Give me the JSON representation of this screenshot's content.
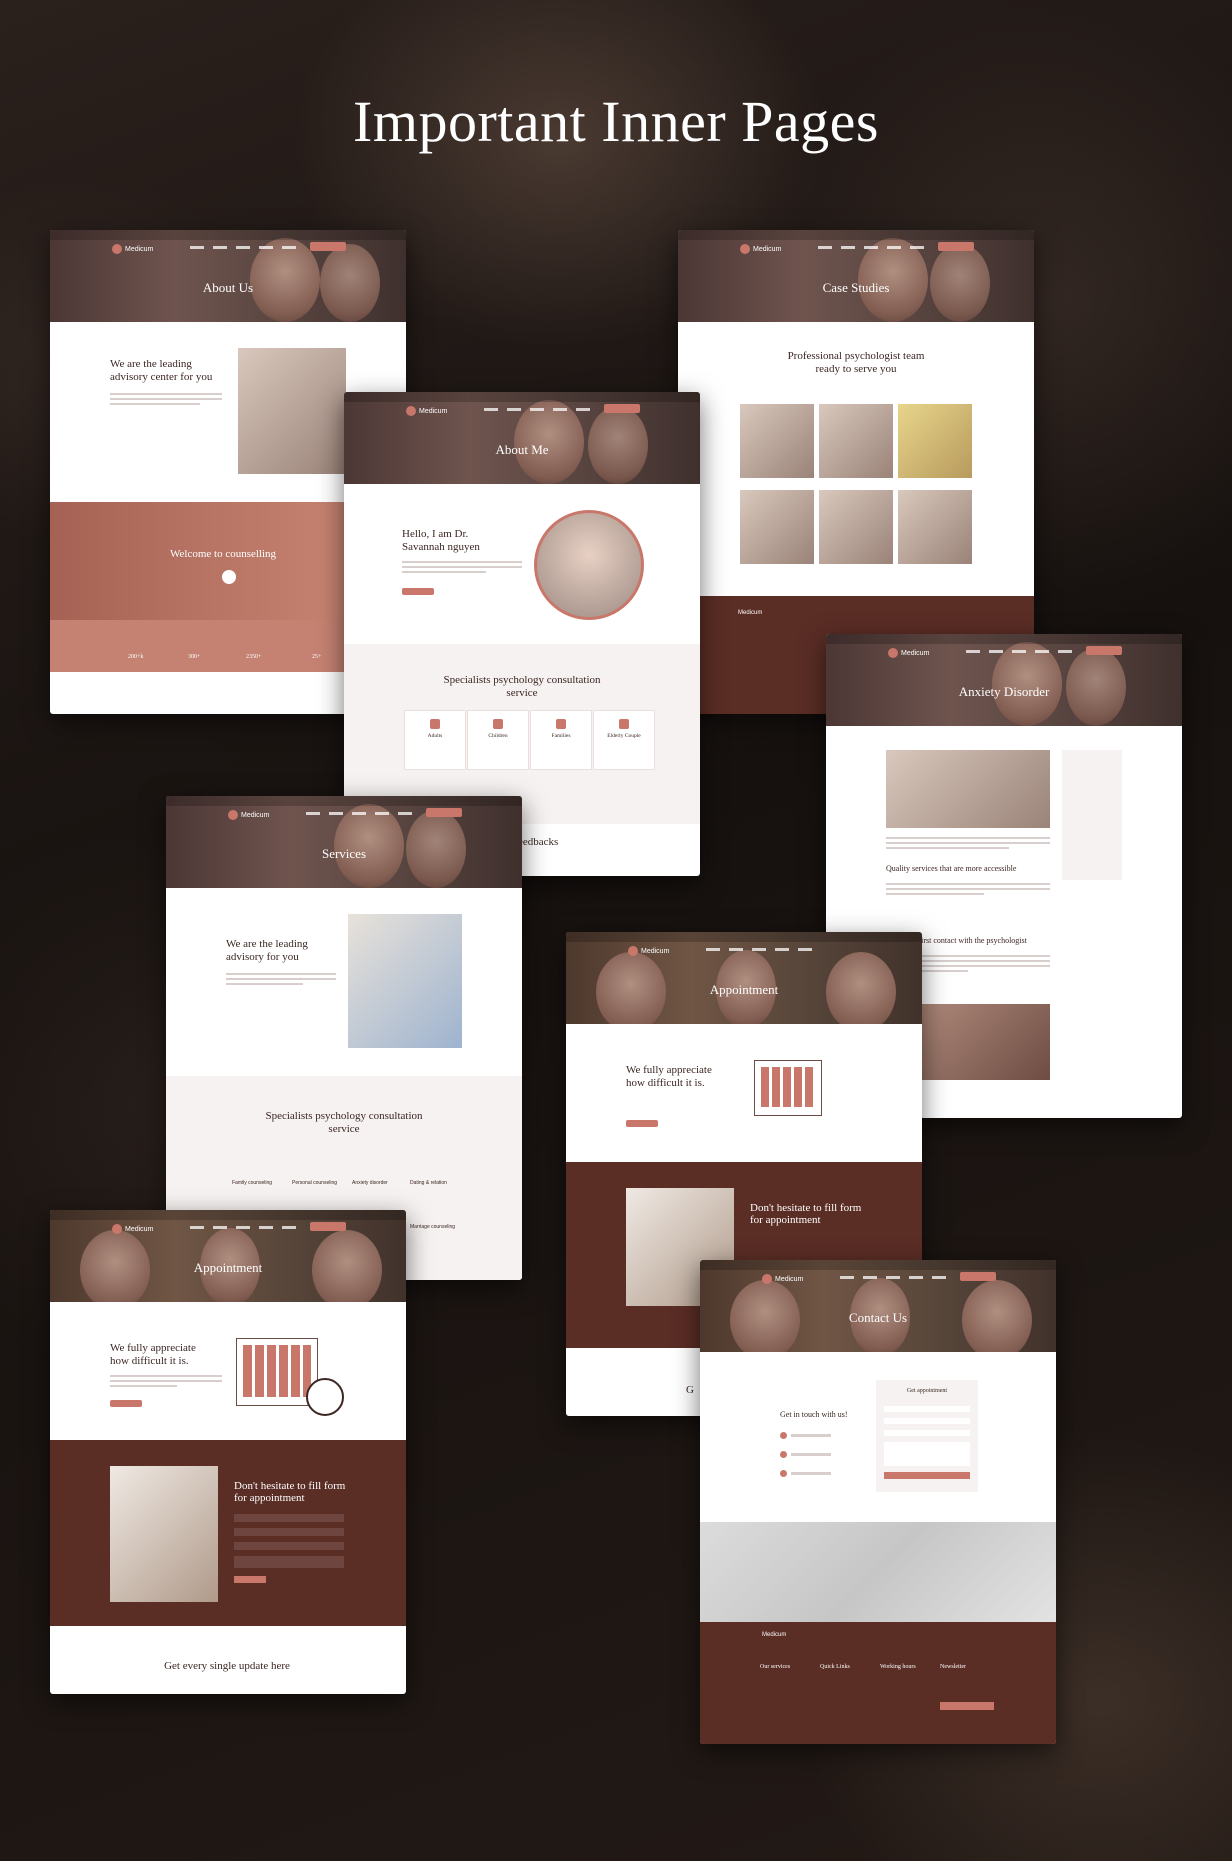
{
  "page": {
    "title": "Important Inner Pages"
  },
  "brand": {
    "logo_text": "Medicum",
    "accent_color": "#c9776a",
    "dark_color": "#5a2d25"
  },
  "pages": {
    "about_us": {
      "hero_title": "About Us",
      "heading": "We are the leading advisory center for you",
      "banner": "Welcome to counselling",
      "stats": [
        "200+k",
        "300+",
        "2350+",
        "25+"
      ]
    },
    "about_me": {
      "hero_title": "About Me",
      "heading": "Hello, I am Dr. Savannah nguyen",
      "section": "Specialists psychology consultation service",
      "services": [
        "Adults",
        "Children",
        "Families",
        "Elderly Couple"
      ],
      "feedbacks_fragment": "eedbacks"
    },
    "case_studies": {
      "hero_title": "Case Studies",
      "heading": "Professional psychologist team ready to serve you"
    },
    "anxiety": {
      "hero_title": "Anxiety Disorder",
      "subheading_1": "Quality services that are more accessible",
      "subheading_2": "An easier first contact with the psychologist"
    },
    "services": {
      "hero_title": "Services",
      "heading": "We are the leading advisory for you",
      "section": "Specialists psychology consultation service",
      "items": [
        "Family counseling",
        "Personal counseling",
        "Anxiety disorder",
        "Dating & relation",
        "Marriage counseling"
      ]
    },
    "appointment_small": {
      "hero_title": "Appointment",
      "heading": "We fully appreciate how difficult it is.",
      "form_heading": "Don't hesitate to fill form for appointment",
      "footer_fragment": "G"
    },
    "appointment": {
      "hero_title": "Appointment",
      "heading": "We fully appreciate how difficult it is.",
      "form_heading": "Don't hesitate to fill form for appointment",
      "newsletter": "Get every single update here"
    },
    "contact": {
      "hero_title": "Contact Us",
      "heading": "Get in touch with us!",
      "form_heading": "Get appointment",
      "footer_cols": [
        "Our services",
        "Quick Links",
        "Working hours",
        "Newsletter"
      ]
    }
  }
}
